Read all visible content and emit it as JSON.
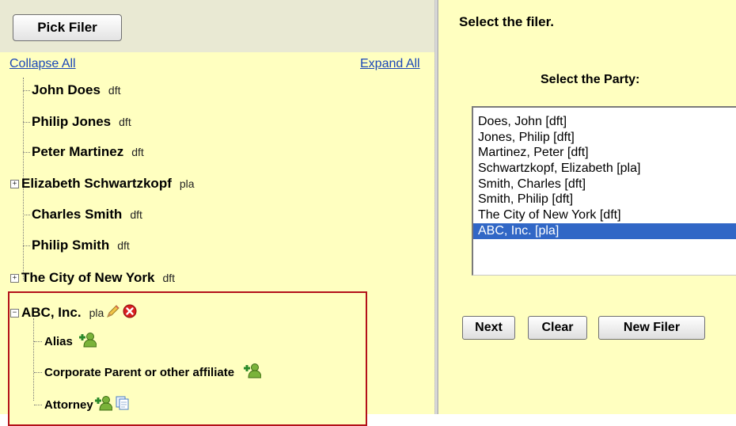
{
  "left_panel": {
    "pick_filer_label": "Pick Filer",
    "collapse_all": "Collapse All",
    "expand_all": "Expand All",
    "tree": [
      {
        "name": "John Does",
        "role": "dft",
        "toggle": ""
      },
      {
        "name": "Philip Jones",
        "role": "dft",
        "toggle": ""
      },
      {
        "name": "Peter Martinez",
        "role": "dft",
        "toggle": ""
      },
      {
        "name": "Elizabeth Schwartzkopf",
        "role": "pla",
        "toggle": "+"
      },
      {
        "name": "Charles Smith",
        "role": "dft",
        "toggle": ""
      },
      {
        "name": "Philip Smith",
        "role": "dft",
        "toggle": ""
      },
      {
        "name": "The City of New York",
        "role": "dft",
        "toggle": "+"
      }
    ],
    "selected_node": {
      "name": "ABC, Inc.",
      "role": "pla",
      "toggle": "−",
      "actions": [
        "pencil-edit-icon",
        "delete-icon"
      ],
      "children": [
        {
          "label": "Alias",
          "icons": [
            "add-person-icon"
          ]
        },
        {
          "label": "Corporate Parent or other affiliate",
          "icons": [
            "add-person-icon"
          ]
        },
        {
          "label": "Attorney",
          "icons": [
            "add-person-icon",
            "copy-icon"
          ]
        }
      ],
      "highlight_color": "#b3111a"
    }
  },
  "right_panel": {
    "step_title": "Select the filer.",
    "party_title": "Select the Party:",
    "party_options": [
      "Does, John  [dft]",
      "Jones, Philip  [dft]",
      "Martinez, Peter  [dft]",
      "Schwartzkopf, Elizabeth  [pla]",
      "Smith, Charles  [dft]",
      "Smith, Philip  [dft]",
      "The City of New York  [dft]",
      "ABC, Inc.  [pla]"
    ],
    "selected_option": "ABC, Inc.  [pla]",
    "buttons": {
      "next": "Next",
      "clear": "Clear",
      "new_filer": "New Filer"
    }
  },
  "colors": {
    "panel_background": "#ffffc0",
    "selection": "#3167c6",
    "link": "#1a47b8"
  }
}
